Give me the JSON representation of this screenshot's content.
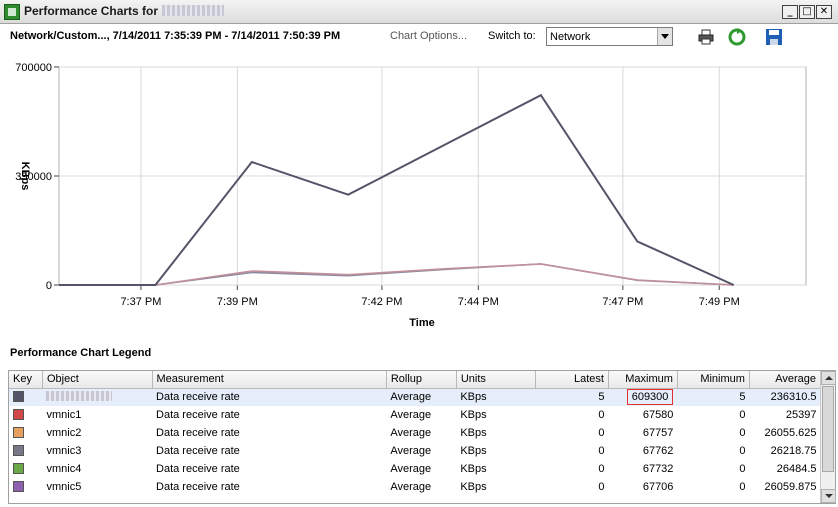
{
  "window": {
    "title": "Performance Charts for",
    "minimize_glyph": "_",
    "maximize_glyph": "□",
    "close_glyph": "✕"
  },
  "toolbar": {
    "context": "Network/Custom..., 7/14/2011 7:35:39 PM - 7/14/2011 7:50:39 PM",
    "chart_options": "Chart Options...",
    "switch_to_label": "Switch to:",
    "switch_to_value": "Network",
    "icons": [
      "printer-icon",
      "refresh-icon",
      "save-icon"
    ],
    "colors": {
      "refresh": "#2f9a2f",
      "save": "#1f5fb5"
    }
  },
  "chart_data": {
    "type": "line",
    "ylabel": "KBps",
    "xlabel": "Time",
    "ylim": [
      0,
      700000
    ],
    "yticks": [
      "0",
      "350000",
      "700000"
    ],
    "xticks": [
      "7:37 PM",
      "7:39 PM",
      "7:42 PM",
      "7:44 PM",
      "7:47 PM",
      "7:49 PM"
    ],
    "grid": true,
    "series": [
      {
        "color": "#545468",
        "x": [
          "7:35:39 PM",
          "7:37:39 PM",
          "7:39:39 PM",
          "7:41:39 PM",
          "7:43:39 PM",
          "7:45:39 PM",
          "7:47:39 PM",
          "7:49:39 PM"
        ],
        "values": [
          0,
          0,
          395000,
          290000,
          450000,
          609300,
          140000,
          0
        ]
      },
      {
        "color": "#c2909a",
        "x": [
          "7:35:39 PM",
          "7:37:39 PM",
          "7:39:39 PM",
          "7:41:39 PM",
          "7:43:39 PM",
          "7:45:39 PM",
          "7:47:39 PM",
          "7:49:39 PM"
        ],
        "values": [
          0,
          0,
          45000,
          33000,
          52000,
          67580,
          16000,
          0
        ]
      },
      {
        "color": "#8a8aa0",
        "x": [
          "7:35:39 PM",
          "7:37:39 PM",
          "7:39:39 PM",
          "7:41:39 PM",
          "7:43:39 PM",
          "7:45:39 PM",
          "7:47:39 PM",
          "7:49:39 PM"
        ],
        "values": [
          0,
          0,
          40000,
          30000,
          50000,
          67760,
          15000,
          0
        ]
      }
    ]
  },
  "legend": {
    "title": "Performance Chart Legend",
    "columns": [
      "Key",
      "Object",
      "Measurement",
      "Rollup",
      "Units",
      "Latest",
      "Maximum",
      "Minimum",
      "Average"
    ],
    "rows": [
      {
        "color": "#545468",
        "object": "",
        "measurement": "Data receive rate",
        "rollup": "Average",
        "units": "KBps",
        "latest": "5",
        "maximum": "609300",
        "minimum": "5",
        "average": "236310.5"
      },
      {
        "color": "#d04848",
        "object": "vmnic1",
        "measurement": "Data receive rate",
        "rollup": "Average",
        "units": "KBps",
        "latest": "0",
        "maximum": "67580",
        "minimum": "0",
        "average": "25397"
      },
      {
        "color": "#e8a060",
        "object": "vmnic2",
        "measurement": "Data receive rate",
        "rollup": "Average",
        "units": "KBps",
        "latest": "0",
        "maximum": "67757",
        "minimum": "0",
        "average": "26055.625"
      },
      {
        "color": "#787888",
        "object": "vmnic3",
        "measurement": "Data receive rate",
        "rollup": "Average",
        "units": "KBps",
        "latest": "0",
        "maximum": "67762",
        "minimum": "0",
        "average": "26218.75"
      },
      {
        "color": "#6aa84a",
        "object": "vmnic4",
        "measurement": "Data receive rate",
        "rollup": "Average",
        "units": "KBps",
        "latest": "0",
        "maximum": "67732",
        "minimum": "0",
        "average": "26484.5"
      },
      {
        "color": "#9060b0",
        "object": "vmnic5",
        "measurement": "Data receive rate",
        "rollup": "Average",
        "units": "KBps",
        "latest": "0",
        "maximum": "67706",
        "minimum": "0",
        "average": "26059.875"
      }
    ]
  }
}
